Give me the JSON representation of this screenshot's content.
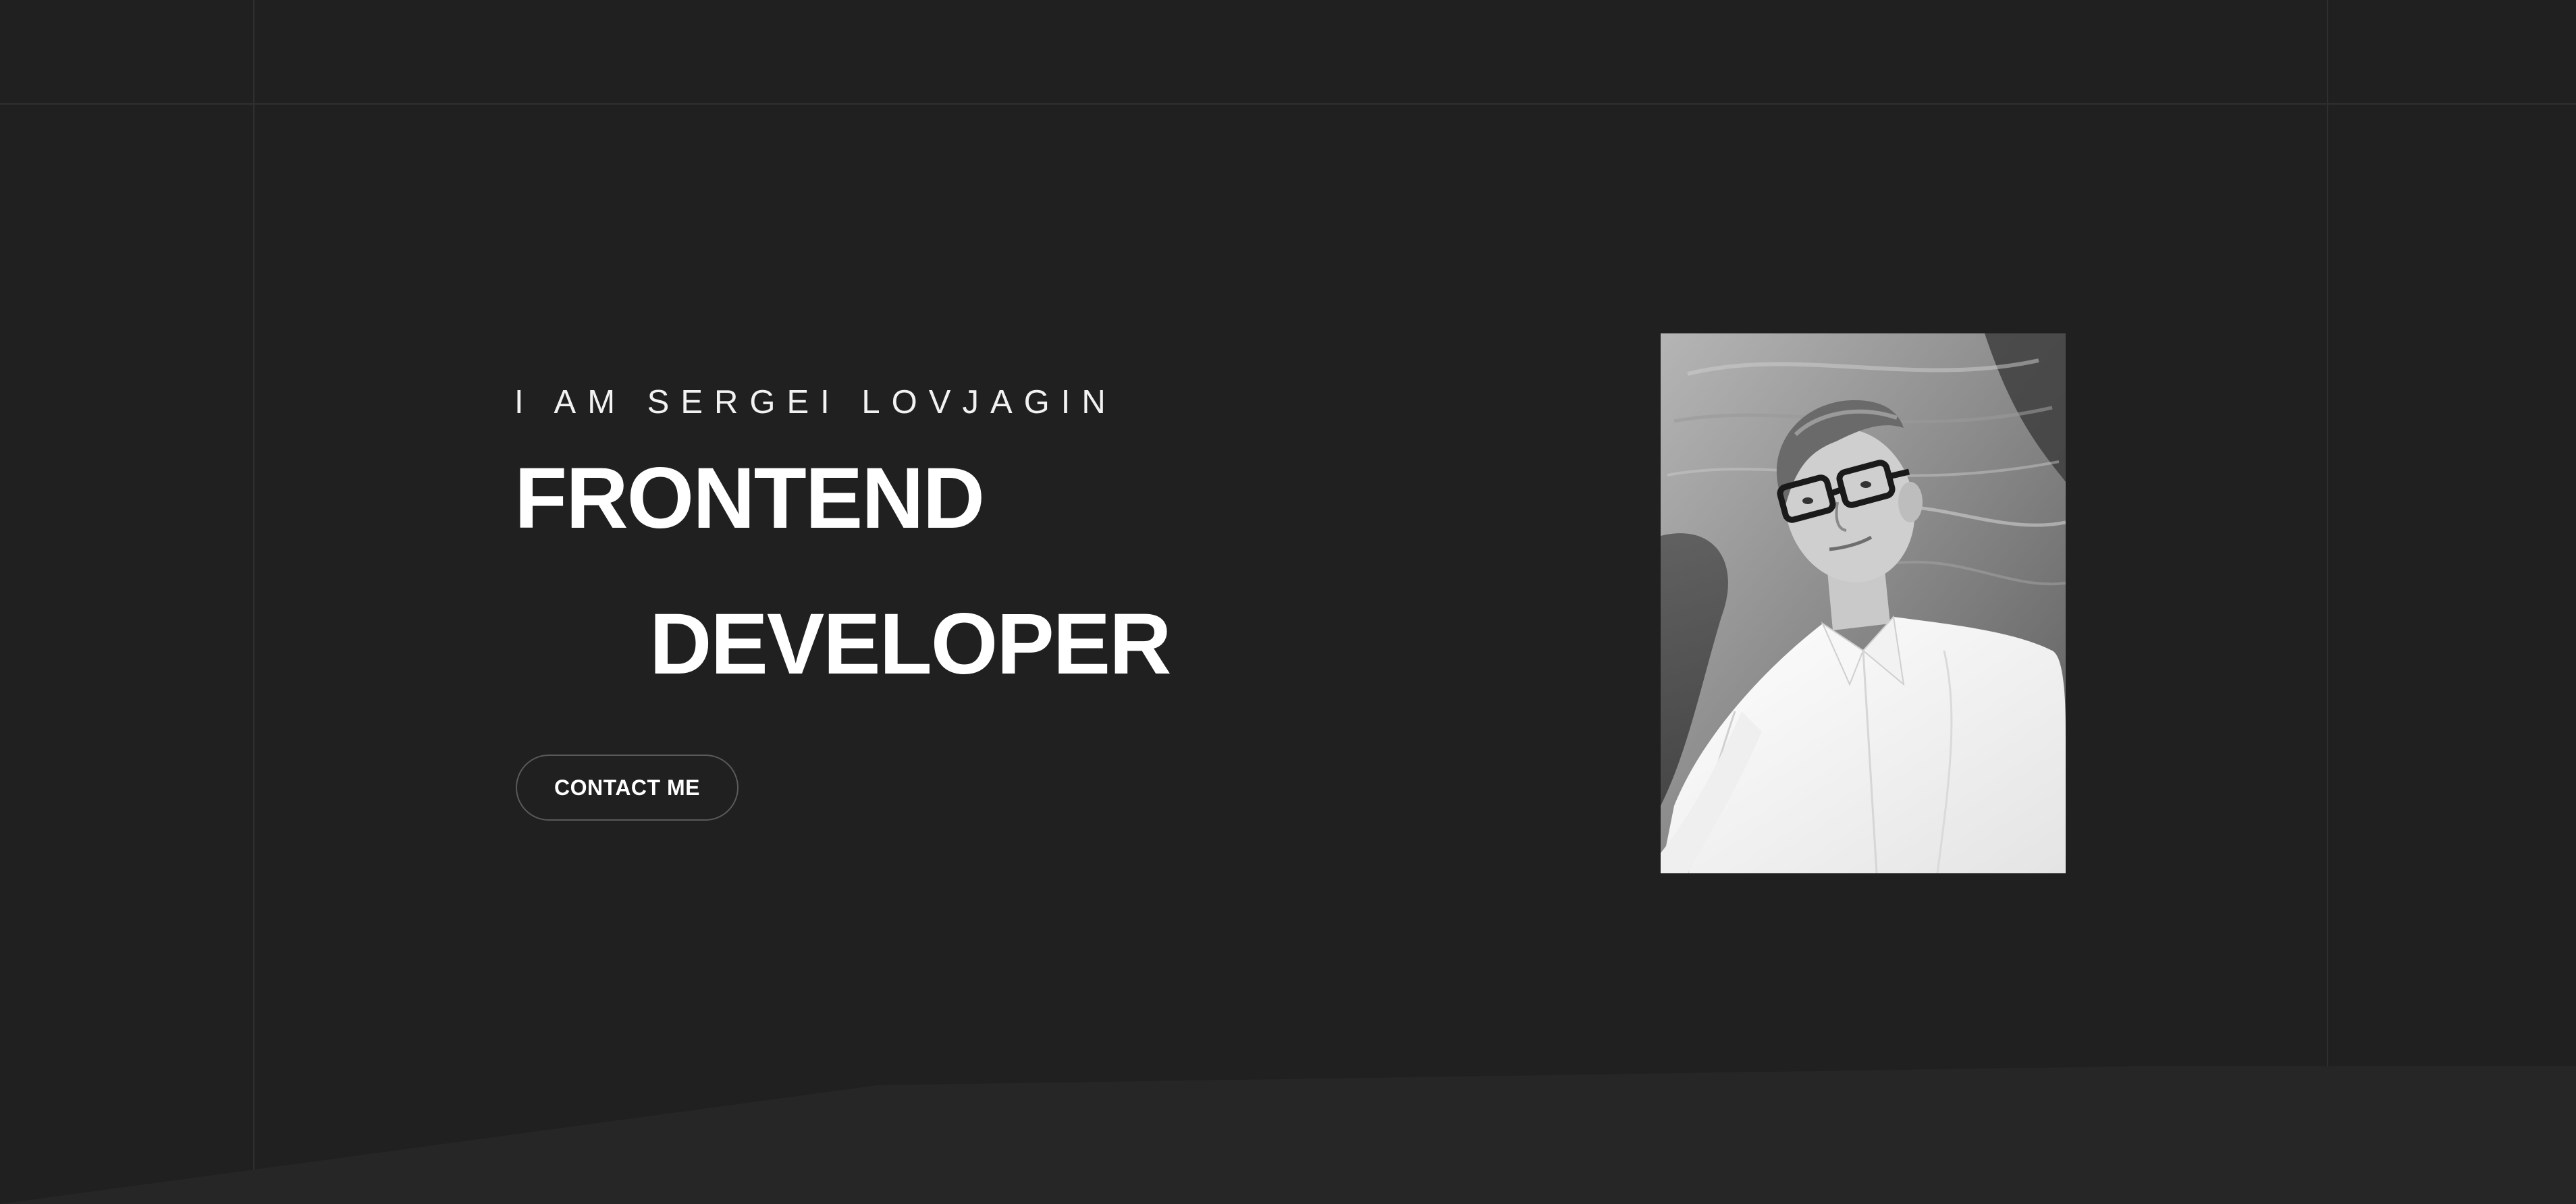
{
  "hero": {
    "intro": "I AM SERGEI LOVJAGIN",
    "title_line_1": "FRONTEND",
    "title_line_2": "DEVELOPER",
    "contact_label": "CONTACT ME"
  },
  "portrait": {
    "description_icon": "portrait-photo",
    "style": "black-and-white"
  },
  "colors": {
    "background": "#202020",
    "grid_line": "#2f2f2f",
    "bottom_shape": "#262626",
    "text": "#ffffff",
    "button_border": "#5a5a5a"
  }
}
